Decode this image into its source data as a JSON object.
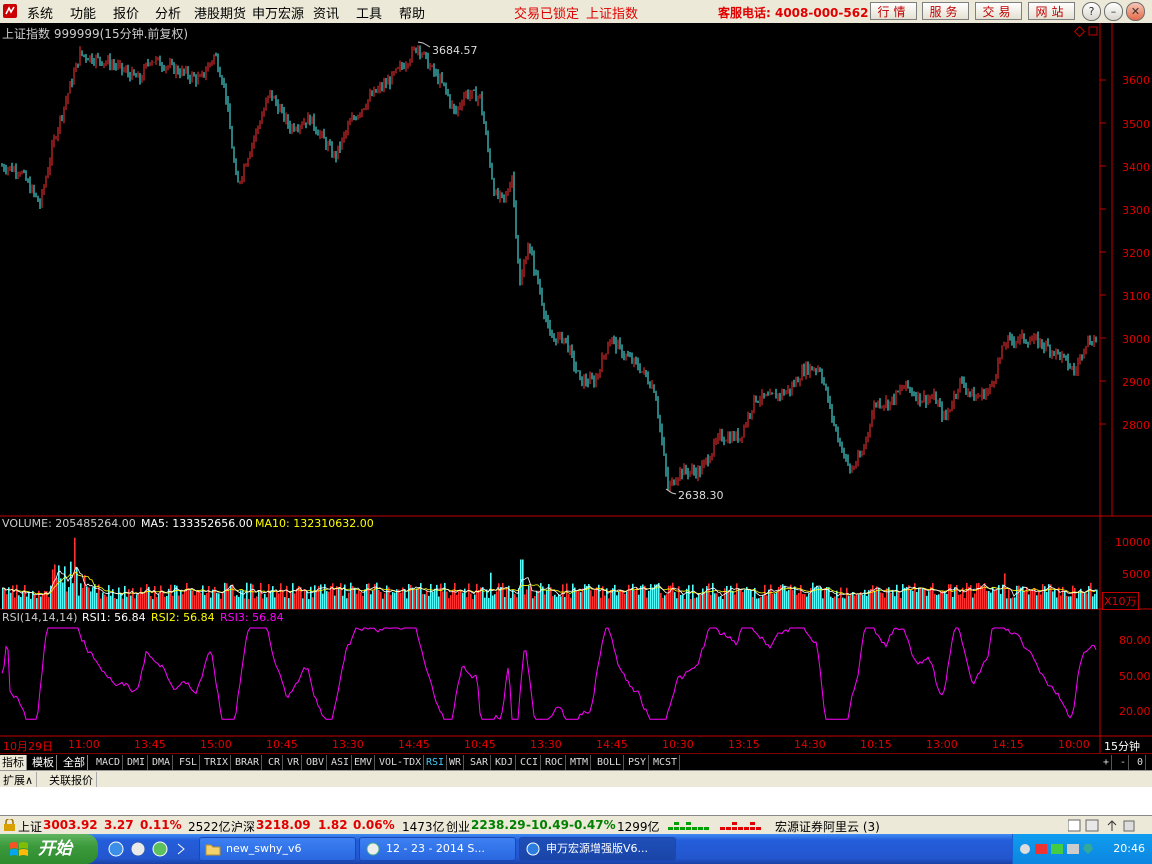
{
  "menu": {
    "items": [
      "系统",
      "功能",
      "报价",
      "分析",
      "港股期货",
      "申万宏源",
      "资讯",
      "工具",
      "帮助"
    ],
    "trade_status": "交易已锁定",
    "current_index": "上证指数",
    "hotline": "客服电话: 4008-000-562",
    "quick_buttons": [
      "行情",
      "服务",
      "交易",
      "网站"
    ],
    "window_controls": {
      "help": "?",
      "minimize": "–",
      "restore": "❐",
      "close": "✕"
    }
  },
  "price_panel": {
    "title": "上证指数 999999(15分钟.前复权)",
    "high_label": "3684.57",
    "low_label": "2638.30",
    "y_ticks": [
      "3600",
      "3500",
      "3400",
      "3300",
      "3200",
      "3100",
      "3000",
      "2900",
      "2800"
    ]
  },
  "volume_panel": {
    "vol_label": "VOLUME: 205485264.00",
    "ma5_label": "MA5: 133352656.00",
    "ma10_label": "MA10: 132310632.00",
    "y_ticks": [
      "10000",
      "5000"
    ],
    "unit": "X10万"
  },
  "rsi_panel": {
    "prefix": "RSI(14,14,14)",
    "rsi1": "RSI1: 56.84",
    "rsi2": "RSI2: 56.84",
    "rsi3": "RSI3: 56.84",
    "y_ticks": [
      "80.00",
      "50.00",
      "20.00"
    ]
  },
  "time_axis": {
    "labels": [
      "10月29日",
      "11:00",
      "13:45",
      "15:00",
      "10:45",
      "13:30",
      "14:45",
      "10:45",
      "13:30",
      "14:45",
      "10:30",
      "13:15",
      "14:30",
      "10:15",
      "13:00",
      "14:15",
      "10:00"
    ],
    "period": "15分钟"
  },
  "indicator_tabs": {
    "left": [
      "指标",
      "模板",
      "全部"
    ],
    "items": [
      "MACD",
      "DMI",
      "DMA",
      "FSL",
      "TRIX",
      "BRAR",
      "CR",
      "VR",
      "OBV",
      "ASI",
      "EMV",
      "VOL-TDX",
      "RSI",
      "WR",
      "SAR",
      "KDJ",
      "CCI",
      "ROC",
      "MTM",
      "BOLL",
      "PSY",
      "MCST"
    ],
    "selected": "RSI",
    "zoom": [
      "+",
      "-",
      "0"
    ]
  },
  "row2_tabs": [
    "扩展∧",
    "关联报价"
  ],
  "statusbar": {
    "sh_name": "上证",
    "sh_price": "3003.92",
    "sh_change": "3.27",
    "sh_pct": "0.11%",
    "sh_amount": "2522亿",
    "hs_name": "沪深",
    "hs_price": "3218.09",
    "hs_change": "1.82",
    "hs_pct": "0.06%",
    "hs_amount": "1473亿",
    "cy_name": "创业",
    "cy_price": "2238.29",
    "cy_change": "-10.49",
    "cy_pct": "-0.47%",
    "cy_amount": "1299亿",
    "server": "宏源证券阿里云 (3)"
  },
  "taskbar": {
    "start": "开始",
    "tasks": [
      "new_swhy_v6",
      "12 - 23 - 2014 S...",
      "申万宏源增强版V6..."
    ],
    "time": "20:46"
  },
  "colors": {
    "up": "#FF3232",
    "down": "#54FCFC",
    "ma5": "#FFFFFF",
    "ma10": "#FFFF00",
    "rsi": "#FF00FF",
    "axis": "#C00000"
  }
}
